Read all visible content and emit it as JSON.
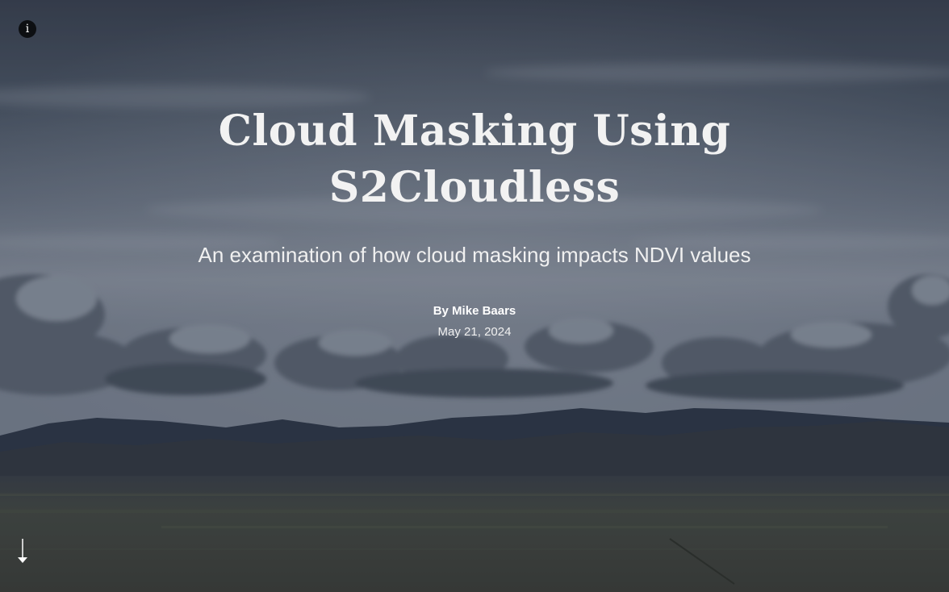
{
  "header": {
    "info_icon": "info-icon",
    "info_glyph": "i"
  },
  "story": {
    "title": "Cloud Masking Using S2Cloudless",
    "subtitle": "An examination of how cloud masking impacts NDVI values",
    "byline": "By Mike Baars",
    "date": "May 21, 2024"
  },
  "footer": {
    "scroll_icon": "arrow-down-icon"
  }
}
